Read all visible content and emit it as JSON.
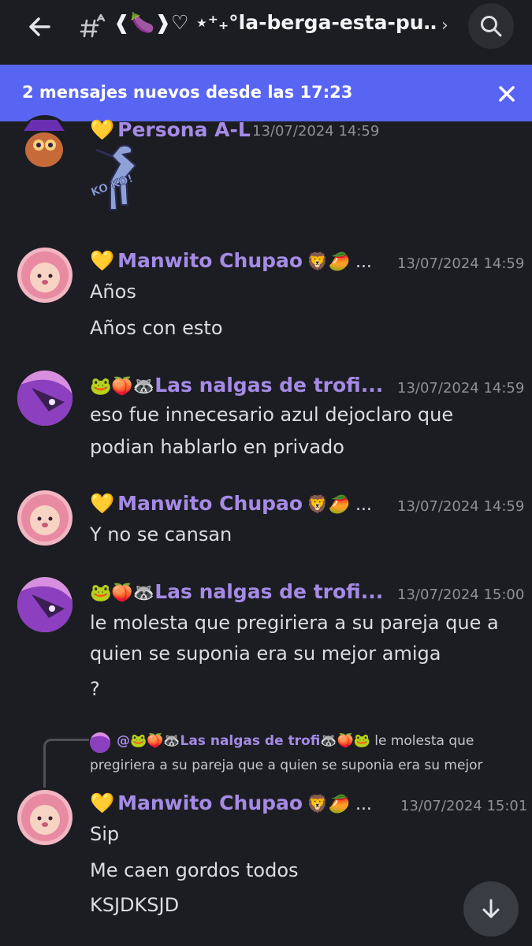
{
  "header": {
    "channel_name": "❰🍆❱♡ ⋆⁺₊°la-berga-esta-pu…",
    "chevron": "›",
    "back_icon": "arrow-left-icon",
    "search_icon": "search-icon"
  },
  "banner": {
    "text": "2 mensajes nuevos desde las 17:23",
    "close_icon": "close-icon"
  },
  "messages": [
    {
      "author": "Persona A-L",
      "badge": "💛",
      "author_emoji": "",
      "timestamp": "13/07/2024 14:59",
      "lines": [],
      "sticker_text": "KO KO!"
    },
    {
      "author": "Manwito Chupao",
      "badge": "💛",
      "author_emoji": "🦁🥭 ...",
      "timestamp": "13/07/2024 14:59",
      "lines": [
        "Años",
        "Años con esto"
      ]
    },
    {
      "author": "Las nalgas de trofi...",
      "badge": "🐸🍑🦝",
      "author_emoji": "",
      "timestamp": "13/07/2024 14:59",
      "lines": [
        "eso fue innecesario  azul dejoclaro que",
        "podian hablarlo en privado"
      ]
    },
    {
      "author": "Manwito Chupao",
      "badge": "💛",
      "author_emoji": "🦁🥭 ...",
      "timestamp": "13/07/2024 14:59",
      "lines": [
        "Y no se cansan"
      ]
    },
    {
      "author": "Las nalgas de trofi...",
      "badge": "🐸🍑🦝",
      "author_emoji": "",
      "timestamp": "13/07/2024 15:00",
      "lines": [
        "le molesta que pregiriera a su pareja que a",
        "quien se suponia era su mejor amiga",
        "?"
      ]
    },
    {
      "author": "Manwito Chupao",
      "badge": "💛",
      "author_emoji": "🦁🥭 ...",
      "timestamp": "13/07/2024 15:01",
      "lines": [
        "Sip",
        "Me caen gordos todos",
        "KSJDKSJD"
      ],
      "reply": {
        "author": "@🐸🍑🦝Las nalgas de trofi🦝🍑🐸",
        "text_line1": "le molesta que",
        "text_line2": "pregiriera a su pareja que a quien se suponia era su mejor"
      }
    }
  ],
  "jump_button": {
    "icon": "arrow-down-icon"
  },
  "colors": {
    "background": "#1c1d22",
    "banner": "#5865f2",
    "username": "#a58be6",
    "timestamp": "#8e9097",
    "text": "#dcdde1"
  }
}
